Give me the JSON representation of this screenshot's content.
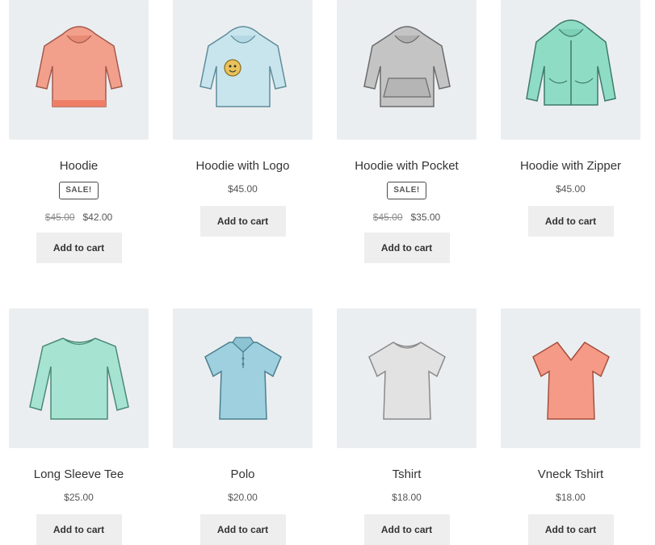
{
  "products": [
    {
      "name": "Hoodie",
      "sale_badge": "SALE!",
      "old_price": "$45.00",
      "price": "$42.00",
      "button": "Add to cart",
      "color": "#f2a08c",
      "icon": "hoodie-icon"
    },
    {
      "name": "Hoodie with Logo",
      "price": "$45.00",
      "button": "Add to cart",
      "color": "#bfe0ea",
      "icon": "hoodie-logo-icon"
    },
    {
      "name": "Hoodie with Pocket",
      "sale_badge": "SALE!",
      "old_price": "$45.00",
      "price": "$35.00",
      "button": "Add to cart",
      "color": "#bdbdbd",
      "icon": "hoodie-pocket-icon"
    },
    {
      "name": "Hoodie with Zipper",
      "price": "$45.00",
      "button": "Add to cart",
      "color": "#8fdcc4",
      "icon": "hoodie-zipper-icon"
    },
    {
      "name": "Long Sleeve Tee",
      "price": "$25.00",
      "button": "Add to cart",
      "color": "#a6e3d0",
      "icon": "long-sleeve-tee-icon"
    },
    {
      "name": "Polo",
      "price": "$20.00",
      "button": "Add to cart",
      "color": "#9fd0df",
      "icon": "polo-shirt-icon"
    },
    {
      "name": "Tshirt",
      "price": "$18.00",
      "button": "Add to cart",
      "color": "#dedede",
      "icon": "tshirt-icon"
    },
    {
      "name": "Vneck Tshirt",
      "price": "$18.00",
      "button": "Add to cart",
      "color": "#f59a86",
      "icon": "vneck-tshirt-icon"
    }
  ]
}
